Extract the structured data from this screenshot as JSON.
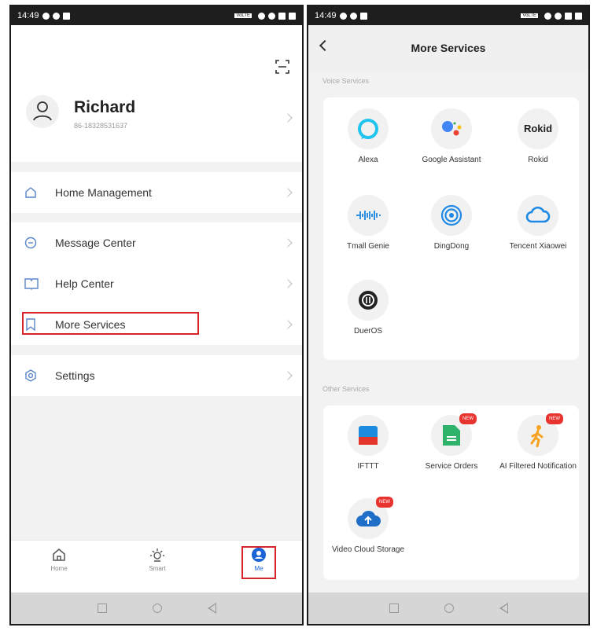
{
  "status": {
    "time": "14:49",
    "battery_tag": "VoLTE"
  },
  "left": {
    "user": {
      "name": "Richard",
      "phone": "86-18328531637"
    },
    "menu": [
      {
        "label": "Home Management"
      },
      {
        "label": "Message Center"
      },
      {
        "label": "Help Center"
      },
      {
        "label": "More Services"
      },
      {
        "label": "Settings"
      }
    ],
    "tabs": [
      {
        "label": "Home"
      },
      {
        "label": "Smart"
      },
      {
        "label": "Me"
      }
    ],
    "highlight_color": "#d9252a"
  },
  "right": {
    "title": "More Services",
    "voice_section": "Voice Services",
    "voice_services": [
      {
        "label": "Alexa",
        "icon": "alexa-icon"
      },
      {
        "label": "Google Assistant",
        "icon": "google-assistant-icon"
      },
      {
        "label": "Rokid",
        "icon": "rokid-icon",
        "logo_text": "Rokid"
      },
      {
        "label": "Tmall Genie",
        "icon": "tmall-genie-icon"
      },
      {
        "label": "DingDong",
        "icon": "dingdong-icon"
      },
      {
        "label": "Tencent Xiaowei",
        "icon": "tencent-xiaowei-icon"
      },
      {
        "label": "DuerOS",
        "icon": "dueros-icon"
      }
    ],
    "other_section": "Other Services",
    "other_services": [
      {
        "label": "IFTTT",
        "icon": "ifttt-icon"
      },
      {
        "label": "Service Orders",
        "icon": "service-orders-icon",
        "badge": "NEW"
      },
      {
        "label": "AI Filtered Notification",
        "icon": "ai-notification-icon",
        "badge": "NEW"
      },
      {
        "label": "Video Cloud Storage",
        "icon": "video-cloud-icon",
        "badge": "NEW"
      }
    ]
  }
}
